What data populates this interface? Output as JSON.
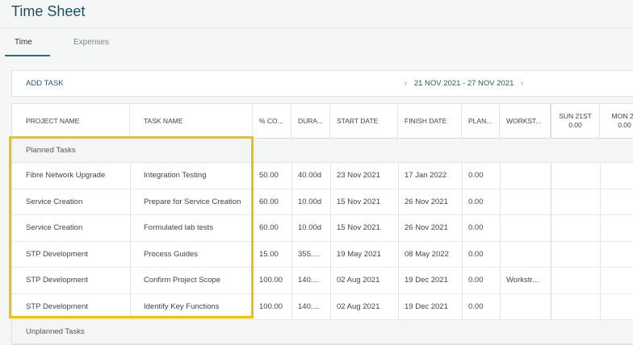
{
  "page": {
    "title": "Time Sheet"
  },
  "tabs": [
    {
      "label": "Time",
      "active": true
    },
    {
      "label": "Expenses",
      "active": false
    }
  ],
  "toolbar": {
    "add_task": "ADD TASK",
    "date_range": "21 NOV 2021 - 27 NOV 2021",
    "prev_icon": "‹",
    "next_icon": "›"
  },
  "columns": {
    "project": "PROJECT NAME",
    "task": "TASK NAME",
    "pct": "% CO...",
    "duration": "DURA...",
    "start": "START DATE",
    "finish": "FINISH DATE",
    "planned": "PLAN...",
    "workstream": "WORKST...",
    "sun": "SUN 21ST",
    "sun_total": "0.00",
    "mon": "MON 22",
    "mon_total": "0.00"
  },
  "groups": {
    "planned": "Planned Tasks",
    "unplanned": "Unplanned Tasks"
  },
  "rows": [
    {
      "project": "Fibre Network Upgrade",
      "task": "Integration Testing",
      "pct": "50.00",
      "duration": "40.00d",
      "start": "23 Nov 2021",
      "finish": "17 Jan 2022",
      "planned": "0.00",
      "workstream": ""
    },
    {
      "project": "Service Creation",
      "task": "Prepare for Service Creation",
      "pct": "60.00",
      "duration": "10.00d",
      "start": "15 Nov 2021",
      "finish": "26 Nov 2021",
      "planned": "0.00",
      "workstream": ""
    },
    {
      "project": "Service Creation",
      "task": "Formulated lab tests",
      "pct": "60.00",
      "duration": "10.00d",
      "start": "15 Nov 2021",
      "finish": "26 Nov 2021",
      "planned": "0.00",
      "workstream": ""
    },
    {
      "project": "STP Development",
      "task": "Process Guides",
      "pct": "15.00",
      "duration": "355....",
      "start": "19 May 2021",
      "finish": "08 May 2022",
      "planned": "0.00",
      "workstream": ""
    },
    {
      "project": "STP Development",
      "task": "Confirm Project Scope",
      "pct": "100.00",
      "duration": "140....",
      "start": "02 Aug 2021",
      "finish": "19 Dec 2021",
      "planned": "0.00",
      "workstream": "Workstr..."
    },
    {
      "project": "STP Development",
      "task": "Identify Key Functions",
      "pct": "100.00",
      "duration": "140....",
      "start": "02 Aug 2021",
      "finish": "19 Dec 2021",
      "planned": "0.00",
      "workstream": ""
    }
  ],
  "colors": {
    "accent": "#1f5d6e",
    "highlight": "#f5c000"
  }
}
